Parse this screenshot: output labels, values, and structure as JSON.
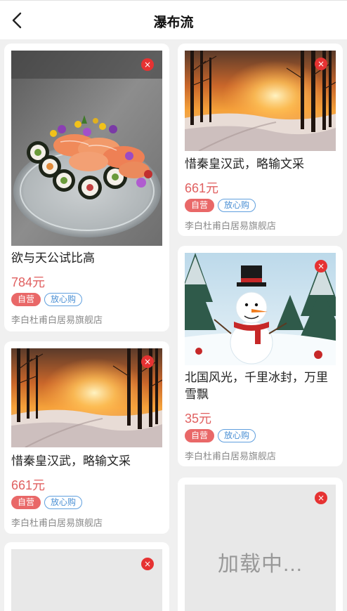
{
  "nav": {
    "title": "瀑布流",
    "back_icon": "chevron-left-icon"
  },
  "left_column": [
    {
      "title": "欲与天公试比高",
      "price": "784元",
      "tag_self": "自营",
      "tag_safe": "放心购",
      "shop": "李白杜甫白居易旗舰店",
      "image": "sushi platter with flowers"
    },
    {
      "title": "惜秦皇汉武，略输文采",
      "price": "661元",
      "tag_self": "自营",
      "tag_safe": "放心购",
      "shop": "李白杜甫白居易旗舰店",
      "image": "sunset over snowy forest"
    },
    {
      "loading": true
    }
  ],
  "right_column": [
    {
      "title": "惜秦皇汉武，略输文采",
      "price": "661元",
      "tag_self": "自营",
      "tag_safe": "放心购",
      "shop": "李白杜甫白居易旗舰店",
      "image": "sunset over snowy forest"
    },
    {
      "title": "北国风光，千里冰封，万里雪飘",
      "price": "35元",
      "tag_self": "自营",
      "tag_safe": "放心购",
      "shop": "李白杜甫白居易旗舰店",
      "image": "snowman with top hat"
    },
    {
      "loading_text": "加载中..."
    }
  ],
  "close_glyph": "×",
  "colors": {
    "price": "#e06060",
    "tag_self_bg": "#e96868",
    "tag_safe": "#4a8fd4",
    "close_bg": "#e63232",
    "background": "#f0f0f0"
  }
}
